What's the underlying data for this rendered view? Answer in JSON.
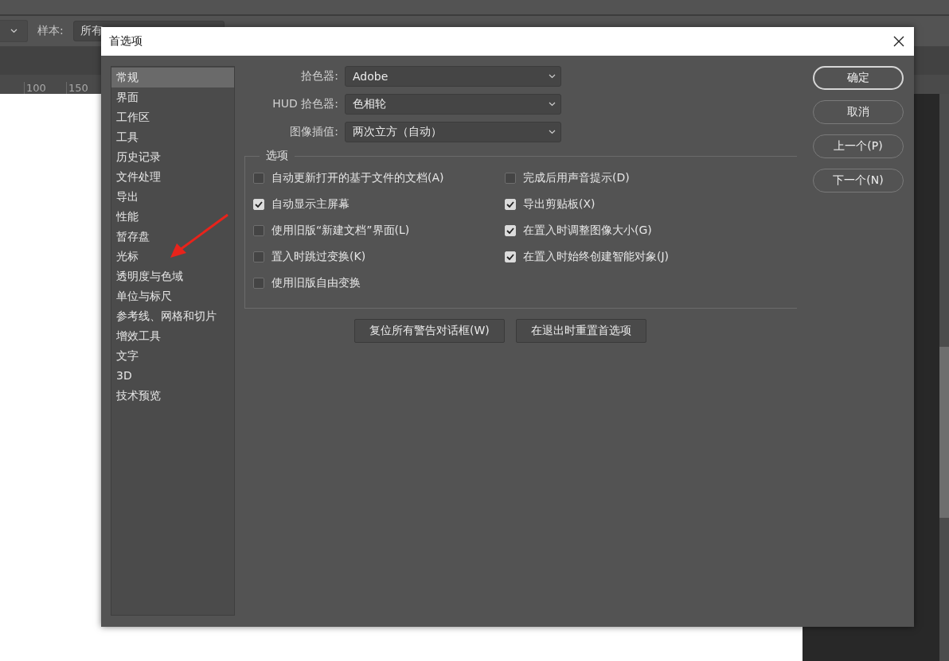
{
  "background": {
    "sample_label": "样本:",
    "sample_value": "所有",
    "ruler": [
      "100",
      "150"
    ]
  },
  "dialog": {
    "title": "首选项",
    "categories": [
      {
        "label": "常规",
        "selected": true
      },
      {
        "label": "界面",
        "selected": false
      },
      {
        "label": "工作区",
        "selected": false
      },
      {
        "label": "工具",
        "selected": false
      },
      {
        "label": "历史记录",
        "selected": false
      },
      {
        "label": "文件处理",
        "selected": false
      },
      {
        "label": "导出",
        "selected": false
      },
      {
        "label": "性能",
        "selected": false
      },
      {
        "label": "暂存盘",
        "selected": false
      },
      {
        "label": "光标",
        "selected": false
      },
      {
        "label": "透明度与色域",
        "selected": false
      },
      {
        "label": "单位与标尺",
        "selected": false
      },
      {
        "label": "参考线、网格和切片",
        "selected": false
      },
      {
        "label": "增效工具",
        "selected": false
      },
      {
        "label": "文字",
        "selected": false
      },
      {
        "label": "3D",
        "selected": false
      },
      {
        "label": "技术预览",
        "selected": false
      }
    ],
    "pickers": [
      {
        "label": "拾色器:",
        "value": "Adobe"
      },
      {
        "label": "HUD 拾色器:",
        "value": "色相轮"
      },
      {
        "label": "图像插值:",
        "value": "两次立方（自动）"
      }
    ],
    "options": {
      "title": "选项",
      "left": [
        {
          "label": "自动更新打开的基于文件的文档(A)",
          "checked": false
        },
        {
          "label": "自动显示主屏幕",
          "checked": true
        },
        {
          "label": "使用旧版“新建文档”界面(L)",
          "checked": false
        },
        {
          "label": "置入时跳过变换(K)",
          "checked": false
        },
        {
          "label": "使用旧版自由变换",
          "checked": false
        }
      ],
      "right": [
        {
          "label": "完成后用声音提示(D)",
          "checked": false
        },
        {
          "label": "导出剪贴板(X)",
          "checked": true
        },
        {
          "label": "在置入时调整图像大小(G)",
          "checked": true
        },
        {
          "label": "在置入时始终创建智能对象(J)",
          "checked": true
        }
      ]
    },
    "reset_buttons": [
      "复位所有警告对话框(W)",
      "在退出时重置首选项"
    ],
    "side_buttons": [
      {
        "label": "确定",
        "default": true
      },
      {
        "label": "取消",
        "default": false
      },
      {
        "label": "上一个(P)",
        "default": false
      },
      {
        "label": "下一个(N)",
        "default": false
      }
    ]
  }
}
